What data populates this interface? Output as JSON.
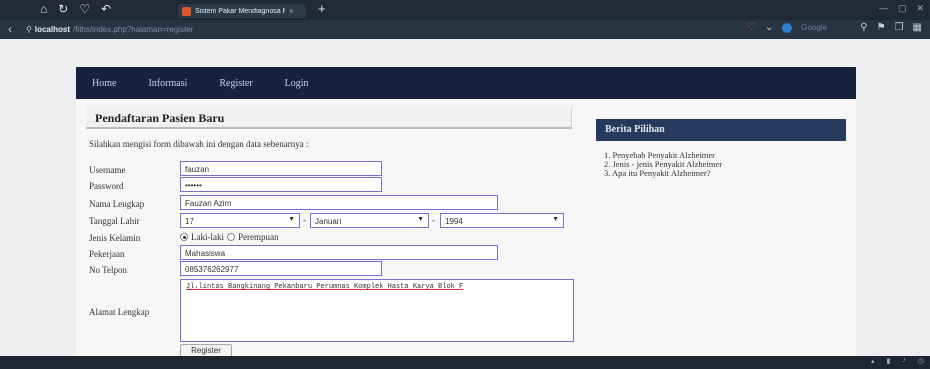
{
  "browser": {
    "tab_title": "Sistem Pakar Mendiagnosa P...",
    "tab_close": "×",
    "new_tab": "+",
    "url_host": "localhost",
    "url_path": "/fiths/index.php?halaman=register",
    "search_placeholder": "Google"
  },
  "nav": {
    "items": [
      "Home",
      "Informasi",
      "Register",
      "Login"
    ]
  },
  "form": {
    "title": "Pendaftaran Pasien Baru",
    "intro": "Silahkan mengisi form dibawah ini dengan data sebenarnya :",
    "labels": {
      "username": "Username",
      "password": "Password",
      "name": "Nama Lengkap",
      "dob": "Tanggal Lahir",
      "gender": "Jenis Kelamin",
      "job": "Pekerjaan",
      "phone": "No Telpon",
      "address": "Alamat Lengkap"
    },
    "values": {
      "username": "fauzan",
      "password": "••••••",
      "name": "Fauzan Azim",
      "dob_day": "17",
      "dob_month": "Januari",
      "dob_year": "1994",
      "job": "Mahasiswa",
      "phone": "085376262977",
      "address": "Jl.lintas Bangkinang Pekanbaru Perumnas Komplek Hasta Karya Blok F"
    },
    "dob_separator": "-",
    "gender_options": [
      "Laki-laki",
      "Perempuan"
    ],
    "gender_selected": "Laki-laki",
    "submit_label": "Register"
  },
  "sidebar": {
    "title": "Berita Pilihan",
    "items": [
      "1. Penyebab Penyakit Alzheimer",
      "2. Jenis - jenis Penyakit Alzheimer",
      "3. Apa itu Penyakit Alzheimer?"
    ]
  }
}
